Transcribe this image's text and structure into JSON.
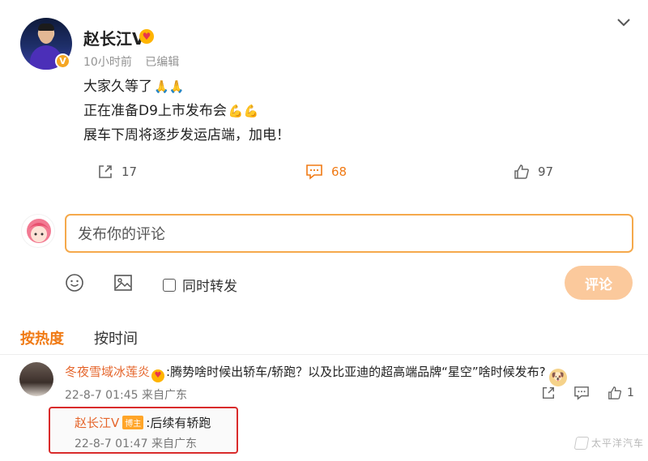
{
  "post": {
    "username": "赵长江V",
    "time": "10小时前",
    "edited": "已编辑",
    "lines": [
      "大家久等了",
      "正在准备D9上市发布会",
      "展车下周将逐步发运店端，加电！"
    ],
    "line_emojis": [
      "🙏🙏",
      "💪💪",
      ""
    ],
    "actions": {
      "repost_count": "17",
      "comment_count": "68",
      "like_count": "97"
    }
  },
  "comment_box": {
    "placeholder": "发布你的评论",
    "repost_label": "同时转发",
    "submit_label": "评论"
  },
  "sort_tabs": {
    "hot": "按热度",
    "time": "按时间"
  },
  "comment": {
    "user": "冬夜雪域冰莲炎",
    "text": ":腾势啥时候出轿车/轿跑？以及比亚迪的超高端品牌“星空”啥时候发布?",
    "meta": "22-8-7 01:45 来自广东",
    "like_count": "1"
  },
  "reply": {
    "user": "赵长江V",
    "tag": "博主",
    "text": ":后续有轿跑",
    "meta": "22-8-7 01:47 来自广东"
  },
  "watermark": "太平洋汽车",
  "colors": {
    "accent": "#f07a14",
    "input_border": "#f5a94b",
    "button_bg": "#fbc99c",
    "username_link": "#e5652b",
    "highlight_box": "#d92b2b"
  }
}
